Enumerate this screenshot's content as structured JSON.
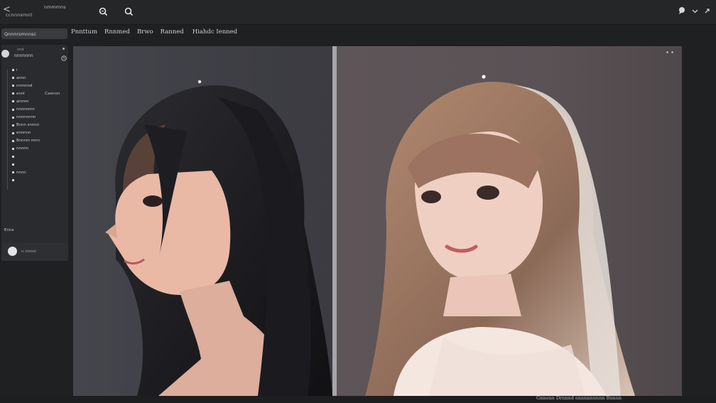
{
  "topbar": {
    "back_glyph": "<",
    "app_title": "ccnnnsmnt",
    "top_text": "nmmmns",
    "icons": [
      "zoom-in-icon",
      "search-icon"
    ],
    "right_icons": [
      "chat-icon",
      "chevron-down-icon",
      "expand-icon"
    ]
  },
  "tabs": [
    "Pnnttum",
    "Rnnmed",
    "Brwo",
    "Ranned",
    "Hiahdc Ienned"
  ],
  "sidebar": {
    "search_placeholder": "Qnnnrsmnnsc",
    "panel": {
      "small_label": "nnd",
      "name": "nnnnnnn",
      "items": [
        {
          "label": "i",
          "aside": ""
        },
        {
          "label": "annn",
          "aside": ""
        },
        {
          "label": "nnmnnd",
          "aside": ""
        },
        {
          "label": "ennl",
          "aside": "Caenon"
        },
        {
          "label": "anmm",
          "aside": ""
        },
        {
          "label": "nnnnnmn",
          "aside": ""
        },
        {
          "label": "nnnnnnnn",
          "aside": ""
        },
        {
          "label": "Bnnn snnnn",
          "aside": ""
        },
        {
          "label": "ennnnn",
          "aside": ""
        },
        {
          "label": "Bnnnm mnn",
          "aside": ""
        },
        {
          "label": "nnnnn",
          "aside": ""
        },
        {
          "label": "",
          "aside": ""
        },
        {
          "label": "",
          "aside": ""
        },
        {
          "label": "nnnn",
          "aside": ""
        },
        {
          "label": "",
          "aside": ""
        }
      ],
      "footer_label": "Enns"
    },
    "foot_card_text": "n nnnnl"
  },
  "canvas": {
    "left_pane_label": "portrait-image-left",
    "right_pane_label": "portrait-image-right"
  },
  "status_text": "Gnnenn Drnnnd ennnnnnnnn Bnnnn",
  "colors": {
    "bg": "#1f2022",
    "panel": "#2a2b2e",
    "divider": "#a6a6aa"
  }
}
